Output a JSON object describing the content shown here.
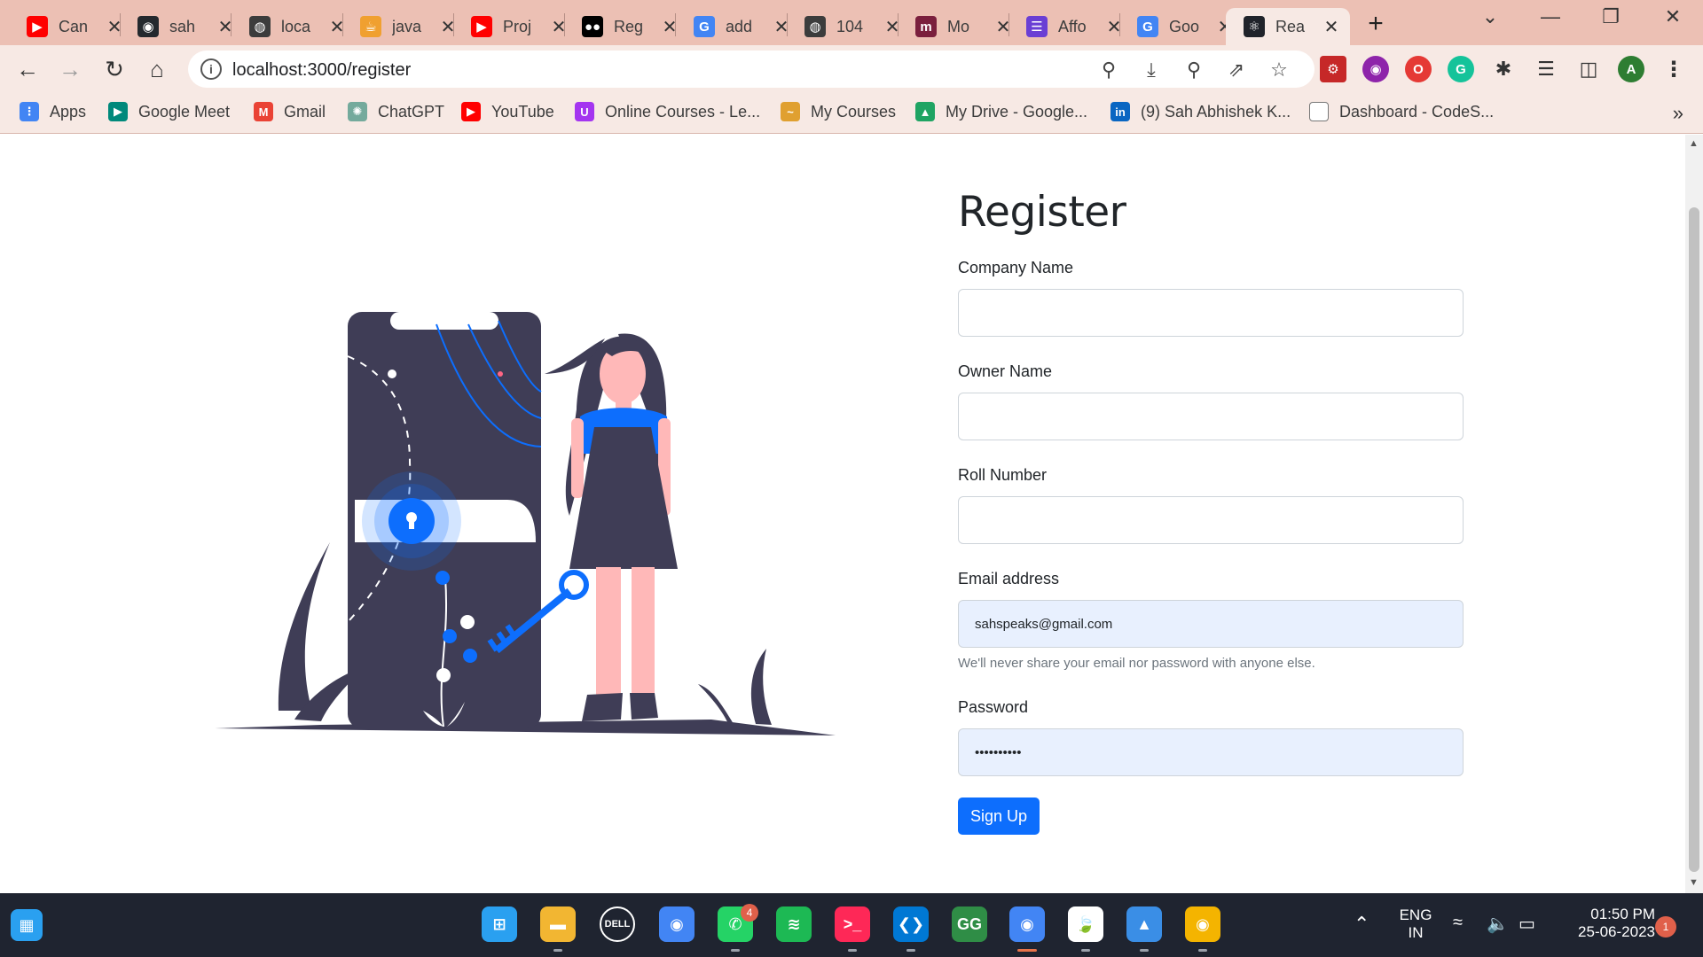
{
  "browser": {
    "tabs": [
      {
        "title": "Can",
        "favicon": "youtube-icon",
        "color": "#ff0000",
        "glyph": "▶"
      },
      {
        "title": "sah",
        "favicon": "github-icon",
        "color": "#24292e",
        "glyph": "◉"
      },
      {
        "title": "loca",
        "favicon": "globe-icon",
        "color": "#3c3c3c",
        "glyph": "◍"
      },
      {
        "title": "java",
        "favicon": "java-icon",
        "color": "#f0a030",
        "glyph": "☕"
      },
      {
        "title": "Proj",
        "favicon": "youtube-icon",
        "color": "#ff0000",
        "glyph": "▶"
      },
      {
        "title": "Reg",
        "favicon": "medium-icon",
        "color": "#000000",
        "glyph": "●●"
      },
      {
        "title": "add",
        "favicon": "google-icon",
        "color": "#4285f4",
        "glyph": "G"
      },
      {
        "title": "104",
        "favicon": "globe-icon",
        "color": "#3c3c3c",
        "glyph": "◍"
      },
      {
        "title": "Mo",
        "favicon": "m-icon",
        "color": "#7a1f3d",
        "glyph": "m"
      },
      {
        "title": "Affo",
        "favicon": "list-icon",
        "color": "#6a3fd4",
        "glyph": "☰"
      },
      {
        "title": "Goo",
        "favicon": "google-icon",
        "color": "#4285f4",
        "glyph": "G"
      },
      {
        "title": "Rea",
        "favicon": "react-icon",
        "color": "#20232a",
        "glyph": "⚛"
      }
    ],
    "new_tab_glyph": "+",
    "url": "localhost:3000/register",
    "bookmarks": [
      {
        "label": "Apps",
        "icon": "apps-grid-icon",
        "color": "#4285f4",
        "glyph": "⋮"
      },
      {
        "label": "Google Meet",
        "icon": "google-meet-icon",
        "color": "#00897b",
        "glyph": "▶"
      },
      {
        "label": "Gmail",
        "icon": "gmail-icon",
        "color": "#ea4335",
        "glyph": "M"
      },
      {
        "label": "ChatGPT",
        "icon": "chatgpt-icon",
        "color": "#74aa9c",
        "glyph": "✺"
      },
      {
        "label": "YouTube",
        "icon": "youtube-icon",
        "color": "#ff0000",
        "glyph": "▶"
      },
      {
        "label": "Online Courses - Le...",
        "icon": "udemy-icon",
        "color": "#a435f0",
        "glyph": "U"
      },
      {
        "label": "My Courses",
        "icon": "courses-icon",
        "color": "#e0a030",
        "glyph": "~"
      },
      {
        "label": "My Drive - Google...",
        "icon": "google-drive-icon",
        "color": "#1fa463",
        "glyph": "▲"
      },
      {
        "label": "(9) Sah Abhishek K...",
        "icon": "linkedin-icon",
        "color": "#0a66c2",
        "glyph": "in"
      },
      {
        "label": "Dashboard - CodeS...",
        "icon": "page-icon",
        "color": "#ffffff",
        "glyph": ""
      }
    ]
  },
  "page": {
    "title": "Register",
    "fields": {
      "company_label": "Company Name",
      "owner_label": "Owner Name",
      "roll_label": "Roll Number",
      "email_label": "Email address",
      "email_value": "sahspeaks@gmail.com",
      "email_help": "We'll never share your email nor password with anyone else.",
      "password_label": "Password",
      "password_value": "ssssssssss"
    },
    "submit_label": "Sign Up"
  },
  "taskbar": {
    "apps": [
      {
        "name": "start",
        "color": "#2aa0f0",
        "glyph": "⊞"
      },
      {
        "name": "file-explorer",
        "color": "#f2b632",
        "glyph": "▬"
      },
      {
        "name": "dell",
        "color": "#1f2430",
        "glyph": "DELL"
      },
      {
        "name": "chrome",
        "color": "#4285f4",
        "glyph": "◉"
      },
      {
        "name": "whatsapp",
        "color": "#25d366",
        "glyph": "✆"
      },
      {
        "name": "spotify",
        "color": "#1db954",
        "glyph": "≋"
      },
      {
        "name": "intellij",
        "color": "#fe2857",
        "glyph": ">_"
      },
      {
        "name": "vscode",
        "color": "#0078d4",
        "glyph": "❮❯"
      },
      {
        "name": "geeksforgeeks",
        "color": "#2f8d46",
        "glyph": "GG"
      },
      {
        "name": "chrome-profile",
        "color": "#4285f4",
        "glyph": "◉"
      },
      {
        "name": "mongodb",
        "color": "#ffffff",
        "glyph": "🍃"
      },
      {
        "name": "photos",
        "color": "#3a8ee6",
        "glyph": "▲"
      },
      {
        "name": "chrome-canary",
        "color": "#f4b400",
        "glyph": "◉"
      }
    ],
    "whatsapp_badge": "4",
    "language_top": "ENG",
    "language_bottom": "IN",
    "time": "01:50 PM",
    "date": "25-06-2023",
    "notification_count": "1"
  }
}
